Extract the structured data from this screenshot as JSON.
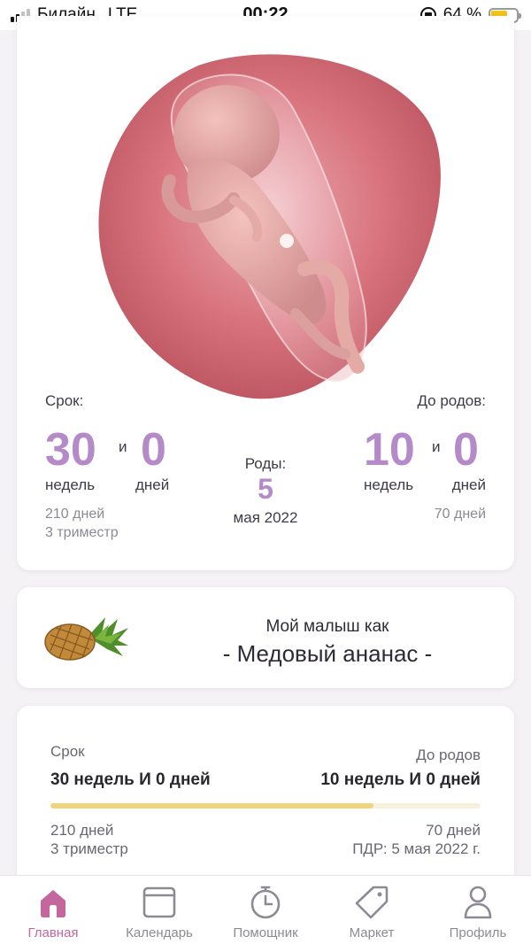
{
  "status_bar": {
    "carrier": "Билайн",
    "network": "LTE",
    "time": "00:22",
    "battery_percent": "64 %",
    "battery_level": 0.64,
    "signal_bars_filled": 2,
    "signal_bars_total": 4
  },
  "pregnancy_card": {
    "term_label": "Срок:",
    "term_weeks": "30",
    "term_conj": "и",
    "term_days": "0",
    "term_weeks_unit": "недель",
    "term_days_unit": "дней",
    "term_total_days": "210 дней",
    "term_trimester": "3 триместр",
    "birth_label": "Роды:",
    "birth_day": "5",
    "birth_month_year": "мая 2022",
    "remain_label": "До родов:",
    "remain_weeks": "10",
    "remain_conj": "и",
    "remain_days": "0",
    "remain_weeks_unit": "недель",
    "remain_days_unit": "дней",
    "remain_total_days": "70 дней"
  },
  "fruit_card": {
    "caption": "Мой малыш как",
    "name": "- Медовый ананас -",
    "icon": "pineapple-image"
  },
  "progress_card": {
    "term_label": "Срок",
    "term_value": "30 недель И 0 дней",
    "remain_label": "До родов",
    "remain_value": "10 недель И 0 дней",
    "progress": 0.75,
    "left_days": "210 дней",
    "left_trimester": "3 триместр",
    "right_days": "70 дней",
    "right_due": "ПДР: 5 мая 2022 г."
  },
  "tab_bar": {
    "tabs": [
      {
        "label": "Главная",
        "icon": "home-icon",
        "active": true
      },
      {
        "label": "Календарь",
        "icon": "calendar-icon",
        "active": false
      },
      {
        "label": "Помощник",
        "icon": "stopwatch-icon",
        "active": false
      },
      {
        "label": "Маркет",
        "icon": "tag-icon",
        "active": false
      },
      {
        "label": "Профиль",
        "icon": "profile-icon",
        "active": false
      }
    ]
  },
  "colors": {
    "accent_purple": "#b48ac8",
    "active_tab": "#c5679f",
    "progress_fill": "#f1d27d",
    "battery": "#f2c21b"
  }
}
